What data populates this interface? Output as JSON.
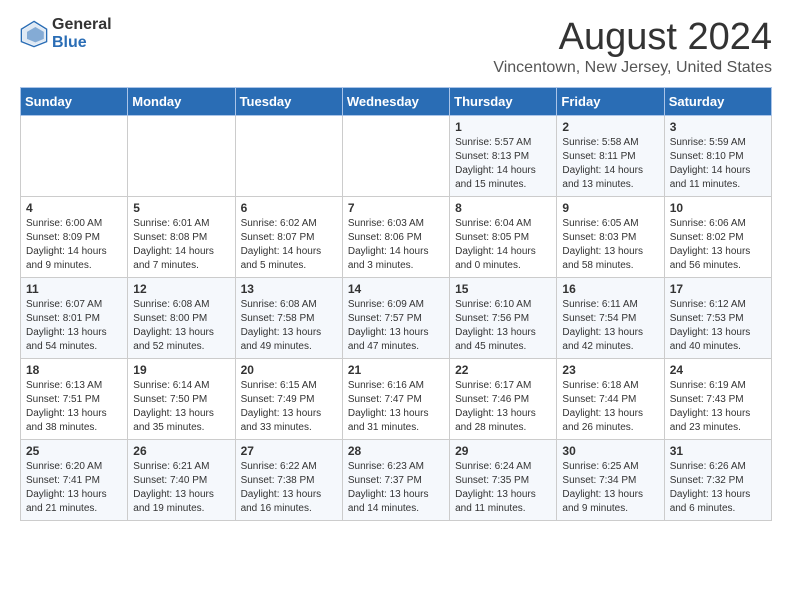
{
  "header": {
    "logo_general": "General",
    "logo_blue": "Blue",
    "main_title": "August 2024",
    "subtitle": "Vincentown, New Jersey, United States"
  },
  "days_of_week": [
    "Sunday",
    "Monday",
    "Tuesday",
    "Wednesday",
    "Thursday",
    "Friday",
    "Saturday"
  ],
  "weeks": [
    [
      {
        "day": "",
        "info": ""
      },
      {
        "day": "",
        "info": ""
      },
      {
        "day": "",
        "info": ""
      },
      {
        "day": "",
        "info": ""
      },
      {
        "day": "1",
        "info": "Sunrise: 5:57 AM\nSunset: 8:13 PM\nDaylight: 14 hours\nand 15 minutes."
      },
      {
        "day": "2",
        "info": "Sunrise: 5:58 AM\nSunset: 8:11 PM\nDaylight: 14 hours\nand 13 minutes."
      },
      {
        "day": "3",
        "info": "Sunrise: 5:59 AM\nSunset: 8:10 PM\nDaylight: 14 hours\nand 11 minutes."
      }
    ],
    [
      {
        "day": "4",
        "info": "Sunrise: 6:00 AM\nSunset: 8:09 PM\nDaylight: 14 hours\nand 9 minutes."
      },
      {
        "day": "5",
        "info": "Sunrise: 6:01 AM\nSunset: 8:08 PM\nDaylight: 14 hours\nand 7 minutes."
      },
      {
        "day": "6",
        "info": "Sunrise: 6:02 AM\nSunset: 8:07 PM\nDaylight: 14 hours\nand 5 minutes."
      },
      {
        "day": "7",
        "info": "Sunrise: 6:03 AM\nSunset: 8:06 PM\nDaylight: 14 hours\nand 3 minutes."
      },
      {
        "day": "8",
        "info": "Sunrise: 6:04 AM\nSunset: 8:05 PM\nDaylight: 14 hours\nand 0 minutes."
      },
      {
        "day": "9",
        "info": "Sunrise: 6:05 AM\nSunset: 8:03 PM\nDaylight: 13 hours\nand 58 minutes."
      },
      {
        "day": "10",
        "info": "Sunrise: 6:06 AM\nSunset: 8:02 PM\nDaylight: 13 hours\nand 56 minutes."
      }
    ],
    [
      {
        "day": "11",
        "info": "Sunrise: 6:07 AM\nSunset: 8:01 PM\nDaylight: 13 hours\nand 54 minutes."
      },
      {
        "day": "12",
        "info": "Sunrise: 6:08 AM\nSunset: 8:00 PM\nDaylight: 13 hours\nand 52 minutes."
      },
      {
        "day": "13",
        "info": "Sunrise: 6:08 AM\nSunset: 7:58 PM\nDaylight: 13 hours\nand 49 minutes."
      },
      {
        "day": "14",
        "info": "Sunrise: 6:09 AM\nSunset: 7:57 PM\nDaylight: 13 hours\nand 47 minutes."
      },
      {
        "day": "15",
        "info": "Sunrise: 6:10 AM\nSunset: 7:56 PM\nDaylight: 13 hours\nand 45 minutes."
      },
      {
        "day": "16",
        "info": "Sunrise: 6:11 AM\nSunset: 7:54 PM\nDaylight: 13 hours\nand 42 minutes."
      },
      {
        "day": "17",
        "info": "Sunrise: 6:12 AM\nSunset: 7:53 PM\nDaylight: 13 hours\nand 40 minutes."
      }
    ],
    [
      {
        "day": "18",
        "info": "Sunrise: 6:13 AM\nSunset: 7:51 PM\nDaylight: 13 hours\nand 38 minutes."
      },
      {
        "day": "19",
        "info": "Sunrise: 6:14 AM\nSunset: 7:50 PM\nDaylight: 13 hours\nand 35 minutes."
      },
      {
        "day": "20",
        "info": "Sunrise: 6:15 AM\nSunset: 7:49 PM\nDaylight: 13 hours\nand 33 minutes."
      },
      {
        "day": "21",
        "info": "Sunrise: 6:16 AM\nSunset: 7:47 PM\nDaylight: 13 hours\nand 31 minutes."
      },
      {
        "day": "22",
        "info": "Sunrise: 6:17 AM\nSunset: 7:46 PM\nDaylight: 13 hours\nand 28 minutes."
      },
      {
        "day": "23",
        "info": "Sunrise: 6:18 AM\nSunset: 7:44 PM\nDaylight: 13 hours\nand 26 minutes."
      },
      {
        "day": "24",
        "info": "Sunrise: 6:19 AM\nSunset: 7:43 PM\nDaylight: 13 hours\nand 23 minutes."
      }
    ],
    [
      {
        "day": "25",
        "info": "Sunrise: 6:20 AM\nSunset: 7:41 PM\nDaylight: 13 hours\nand 21 minutes."
      },
      {
        "day": "26",
        "info": "Sunrise: 6:21 AM\nSunset: 7:40 PM\nDaylight: 13 hours\nand 19 minutes."
      },
      {
        "day": "27",
        "info": "Sunrise: 6:22 AM\nSunset: 7:38 PM\nDaylight: 13 hours\nand 16 minutes."
      },
      {
        "day": "28",
        "info": "Sunrise: 6:23 AM\nSunset: 7:37 PM\nDaylight: 13 hours\nand 14 minutes."
      },
      {
        "day": "29",
        "info": "Sunrise: 6:24 AM\nSunset: 7:35 PM\nDaylight: 13 hours\nand 11 minutes."
      },
      {
        "day": "30",
        "info": "Sunrise: 6:25 AM\nSunset: 7:34 PM\nDaylight: 13 hours\nand 9 minutes."
      },
      {
        "day": "31",
        "info": "Sunrise: 6:26 AM\nSunset: 7:32 PM\nDaylight: 13 hours\nand 6 minutes."
      }
    ]
  ]
}
